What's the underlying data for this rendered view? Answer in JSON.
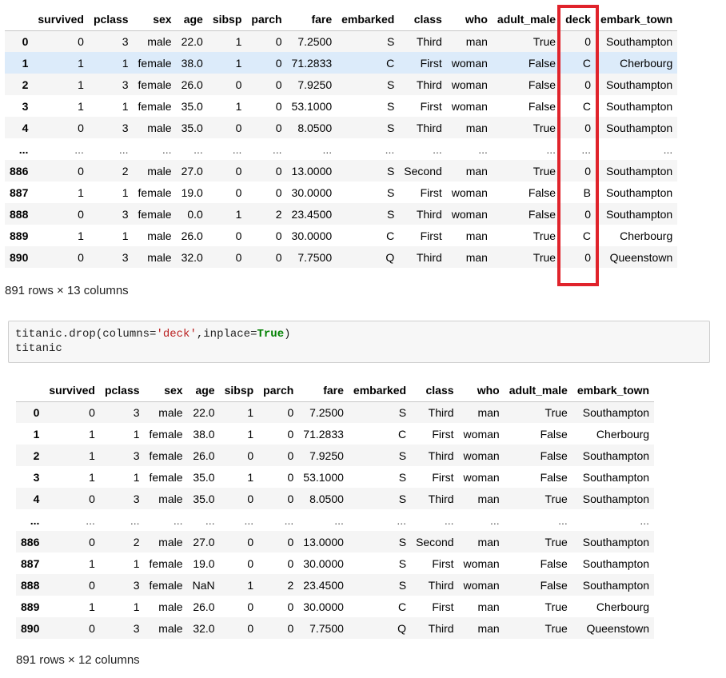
{
  "table1": {
    "columns": [
      "survived",
      "pclass",
      "sex",
      "age",
      "sibsp",
      "parch",
      "fare",
      "embarked",
      "class",
      "who",
      "adult_male",
      "deck",
      "embark_town"
    ],
    "rows": [
      {
        "index": "0",
        "cells": [
          "0",
          "3",
          "male",
          "22.0",
          "1",
          "0",
          "7.2500",
          "S",
          "Third",
          "man",
          "True",
          "0",
          "Southampton"
        ]
      },
      {
        "index": "1",
        "cells": [
          "1",
          "1",
          "female",
          "38.0",
          "1",
          "0",
          "71.2833",
          "C",
          "First",
          "woman",
          "False",
          "C",
          "Cherbourg"
        ]
      },
      {
        "index": "2",
        "cells": [
          "1",
          "3",
          "female",
          "26.0",
          "0",
          "0",
          "7.9250",
          "S",
          "Third",
          "woman",
          "False",
          "0",
          "Southampton"
        ]
      },
      {
        "index": "3",
        "cells": [
          "1",
          "1",
          "female",
          "35.0",
          "1",
          "0",
          "53.1000",
          "S",
          "First",
          "woman",
          "False",
          "C",
          "Southampton"
        ]
      },
      {
        "index": "4",
        "cells": [
          "0",
          "3",
          "male",
          "35.0",
          "0",
          "0",
          "8.0500",
          "S",
          "Third",
          "man",
          "True",
          "0",
          "Southampton"
        ]
      },
      {
        "index": "...",
        "cells": [
          "...",
          "...",
          "...",
          "...",
          "...",
          "...",
          "...",
          "...",
          "...",
          "...",
          "...",
          "...",
          "..."
        ]
      },
      {
        "index": "886",
        "cells": [
          "0",
          "2",
          "male",
          "27.0",
          "0",
          "0",
          "13.0000",
          "S",
          "Second",
          "man",
          "True",
          "0",
          "Southampton"
        ]
      },
      {
        "index": "887",
        "cells": [
          "1",
          "1",
          "female",
          "19.0",
          "0",
          "0",
          "30.0000",
          "S",
          "First",
          "woman",
          "False",
          "B",
          "Southampton"
        ]
      },
      {
        "index": "888",
        "cells": [
          "0",
          "3",
          "female",
          "0.0",
          "1",
          "2",
          "23.4500",
          "S",
          "Third",
          "woman",
          "False",
          "0",
          "Southampton"
        ]
      },
      {
        "index": "889",
        "cells": [
          "1",
          "1",
          "male",
          "26.0",
          "0",
          "0",
          "30.0000",
          "C",
          "First",
          "man",
          "True",
          "C",
          "Cherbourg"
        ]
      },
      {
        "index": "890",
        "cells": [
          "0",
          "3",
          "male",
          "32.0",
          "0",
          "0",
          "7.7500",
          "Q",
          "Third",
          "man",
          "True",
          "0",
          "Queenstown"
        ]
      }
    ],
    "highlighted_row": "1",
    "highlighted_column": "deck",
    "highlight_color": "#e0232b",
    "row_info": "891 rows × 13 columns"
  },
  "code_cell": {
    "line1": {
      "prefix": "titanic.drop(columns=",
      "str": "'deck'",
      "mid": ",inplace=",
      "kw": "True",
      "suffix": ")"
    },
    "line2": "titanic"
  },
  "table2": {
    "columns": [
      "survived",
      "pclass",
      "sex",
      "age",
      "sibsp",
      "parch",
      "fare",
      "embarked",
      "class",
      "who",
      "adult_male",
      "embark_town"
    ],
    "rows": [
      {
        "index": "0",
        "cells": [
          "0",
          "3",
          "male",
          "22.0",
          "1",
          "0",
          "7.2500",
          "S",
          "Third",
          "man",
          "True",
          "Southampton"
        ]
      },
      {
        "index": "1",
        "cells": [
          "1",
          "1",
          "female",
          "38.0",
          "1",
          "0",
          "71.2833",
          "C",
          "First",
          "woman",
          "False",
          "Cherbourg"
        ]
      },
      {
        "index": "2",
        "cells": [
          "1",
          "3",
          "female",
          "26.0",
          "0",
          "0",
          "7.9250",
          "S",
          "Third",
          "woman",
          "False",
          "Southampton"
        ]
      },
      {
        "index": "3",
        "cells": [
          "1",
          "1",
          "female",
          "35.0",
          "1",
          "0",
          "53.1000",
          "S",
          "First",
          "woman",
          "False",
          "Southampton"
        ]
      },
      {
        "index": "4",
        "cells": [
          "0",
          "3",
          "male",
          "35.0",
          "0",
          "0",
          "8.0500",
          "S",
          "Third",
          "man",
          "True",
          "Southampton"
        ]
      },
      {
        "index": "...",
        "cells": [
          "...",
          "...",
          "...",
          "...",
          "...",
          "...",
          "...",
          "...",
          "...",
          "...",
          "...",
          "..."
        ]
      },
      {
        "index": "886",
        "cells": [
          "0",
          "2",
          "male",
          "27.0",
          "0",
          "0",
          "13.0000",
          "S",
          "Second",
          "man",
          "True",
          "Southampton"
        ]
      },
      {
        "index": "887",
        "cells": [
          "1",
          "1",
          "female",
          "19.0",
          "0",
          "0",
          "30.0000",
          "S",
          "First",
          "woman",
          "False",
          "Southampton"
        ]
      },
      {
        "index": "888",
        "cells": [
          "0",
          "3",
          "female",
          "NaN",
          "1",
          "2",
          "23.4500",
          "S",
          "Third",
          "woman",
          "False",
          "Southampton"
        ]
      },
      {
        "index": "889",
        "cells": [
          "1",
          "1",
          "male",
          "26.0",
          "0",
          "0",
          "30.0000",
          "C",
          "First",
          "man",
          "True",
          "Cherbourg"
        ]
      },
      {
        "index": "890",
        "cells": [
          "0",
          "3",
          "male",
          "32.0",
          "0",
          "0",
          "7.7500",
          "Q",
          "Third",
          "man",
          "True",
          "Queenstown"
        ]
      }
    ],
    "row_info": "891 rows × 12 columns"
  }
}
